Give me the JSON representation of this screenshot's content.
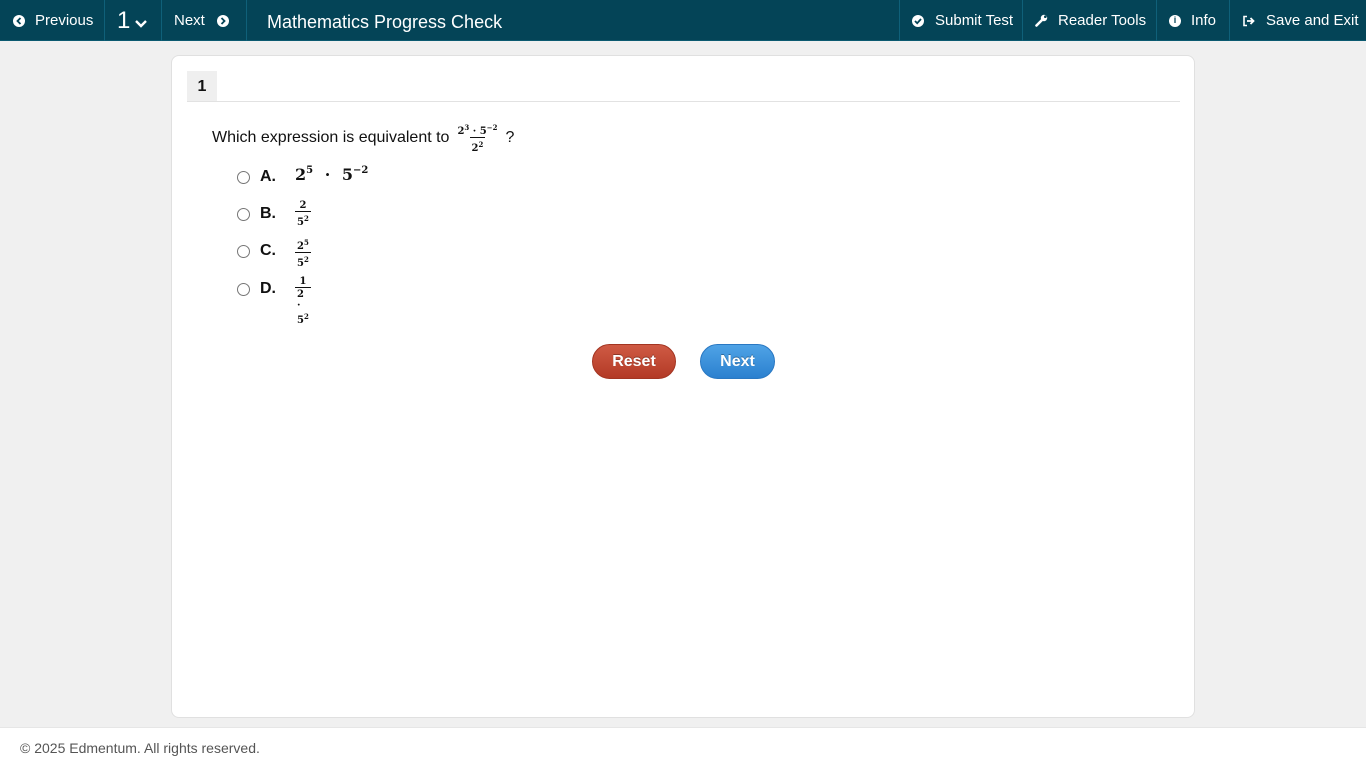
{
  "toolbar": {
    "previous_label": "Previous",
    "question_selector": "1",
    "next_label": "Next",
    "test_title": "Mathematics Progress Check",
    "submit_label": "Submit Test",
    "reader_tools_label": "Reader Tools",
    "info_label": "Info",
    "save_exit_label": "Save and Exit"
  },
  "question": {
    "number": "1",
    "prompt": "Which expression is equivalent to",
    "prompt_end": "?",
    "expression": {
      "num_a": "2",
      "num_a_exp": "3",
      "dot": "·",
      "num_b": "5",
      "num_b_exp": "−2",
      "den": "2",
      "den_exp": "2"
    },
    "options": [
      {
        "letter": "A.",
        "base1": "2",
        "exp1": "5",
        "dot": "·",
        "base2": "5",
        "exp2": "−2"
      },
      {
        "letter": "B.",
        "num": "2",
        "den_base": "5",
        "den_exp": "2"
      },
      {
        "letter": "C.",
        "num_base": "2",
        "num_exp": "5",
        "den_base": "5",
        "den_exp": "2"
      },
      {
        "letter": "D.",
        "num": "1",
        "den_a": "2",
        "dot": "·",
        "den_b": "5",
        "den_exp": "2"
      }
    ]
  },
  "actions": {
    "reset_label": "Reset",
    "next_label": "Next"
  },
  "footer": {
    "copyright": "© 2025 Edmentum. All rights reserved."
  },
  "colors": {
    "topbar": "#044457",
    "reset": "#c0462f",
    "next": "#3b8fd9"
  },
  "icons": [
    "arrow-left-circle-icon",
    "chevron-down-icon",
    "arrow-right-circle-icon",
    "check-circle-icon",
    "wrench-icon",
    "info-circle-icon",
    "sign-out-icon"
  ]
}
